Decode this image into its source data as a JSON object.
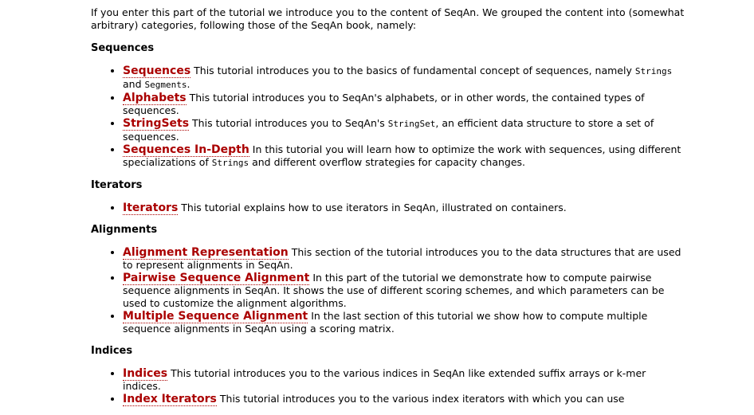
{
  "intro": "If you enter this part of the tutorial we introduce you to the content of SeqAn. We grouped the content into (somewhat arbitrary) categories, following those of the SeqAn book, namely:",
  "sections": {
    "sequences": {
      "heading": "Sequences",
      "items": [
        {
          "link": "Sequences",
          "parts": [
            " This tutorial introduces you to the basics of fundamental concept of sequences, namely ",
            "Strings",
            " and ",
            "Segments",
            "."
          ]
        },
        {
          "link": "Alphabets",
          "desc": " This tutorial introduces you to SeqAn's alphabets, or in other words, the contained types of sequences."
        },
        {
          "link": "StringSets",
          "parts": [
            " This tutorial introduces you to SeqAn's ",
            "StringSet",
            ", an efficient data structure to store a set of sequences."
          ]
        },
        {
          "link": "Sequences In-Depth",
          "parts": [
            " In this tutorial you will learn how to optimize the work with sequences, using different specializations of ",
            "Strings",
            " and different overflow strategies for capacity changes."
          ]
        }
      ]
    },
    "iterators": {
      "heading": "Iterators",
      "items": [
        {
          "link": "Iterators",
          "desc": " This tutorial explains how to use iterators in SeqAn, illustrated on containers."
        }
      ]
    },
    "alignments": {
      "heading": "Alignments",
      "items": [
        {
          "link": "Alignment Representation",
          "desc": " This section of the tutorial introduces you to the data structures that are used to represent alignments in SeqAn."
        },
        {
          "link": "Pairwise Sequence Alignment",
          "desc": " In this part of the tutorial we demonstrate how to compute pairwise sequence alignments in SeqAn. It shows the use of different scoring schemes, and which parameters can be used to customize the alignment algorithms."
        },
        {
          "link": "Multiple Sequence Alignment",
          "desc": " In the last section of this tutorial we show how to compute multiple sequence alignments in SeqAn using a scoring matrix."
        }
      ]
    },
    "indices": {
      "heading": "Indices",
      "items": [
        {
          "link": "Indices",
          "desc": " This tutorial introduces you to the various indices in SeqAn like extended suffix arrays or k-mer indices."
        },
        {
          "link": "Index Iterators",
          "desc": " This tutorial introduces you to the various index iterators with which you can use"
        }
      ]
    }
  },
  "colors": {
    "link": "#aa0000",
    "text": "#000000",
    "background": "#ffffff"
  }
}
